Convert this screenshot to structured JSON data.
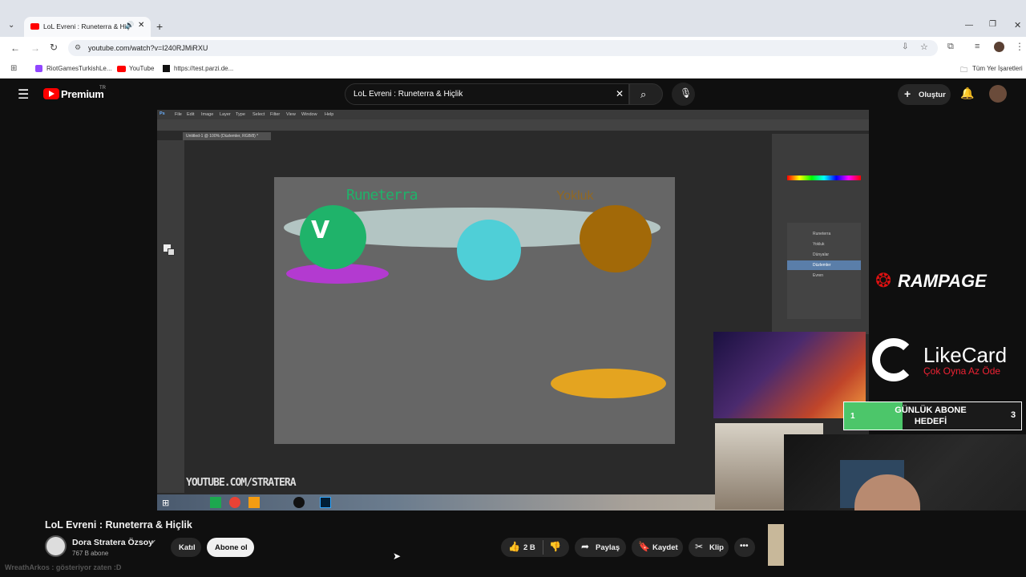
{
  "browser": {
    "tab_title": "LoL Evreni : Runeterra & Hiç",
    "url": "youtube.com/watch?v=I240RJMiRXU",
    "bookmarks": [
      "RiotGamesTurkishLe...",
      "YouTube",
      "https://test.parzi.de..."
    ],
    "bookmarks_right": "Tüm Yer İşaretleri"
  },
  "youtube": {
    "logo_text": "Premium",
    "logo_region": "TR",
    "search_query": "LoL Evreni : Runeterra & Hiçlik",
    "create_label": "Oluştur"
  },
  "video": {
    "ps_menu": [
      "Ps",
      "File",
      "Edit",
      "Image",
      "Layer",
      "Type",
      "Select",
      "Filter",
      "View",
      "Window",
      "Help"
    ],
    "doc_tab": "Untitled-1 @ 100% (Düzlemler, RGB/8) *",
    "canvas_text_runeterra": "Runeterra",
    "canvas_text_yokluk": "Yokluk",
    "layers": [
      "Runeterra",
      "Yokluk",
      "Dünyalar",
      "Düzlemler",
      "Evren"
    ],
    "watermark": "YOUTUBE.COM/STRATERA",
    "overlay_brand": "RAMPAGE",
    "likecard_name": "LikeCard",
    "likecard_slogan": "Çok Oyna  Az Öde",
    "goal_title": "GÜNLÜK ABONE HEDEFİ",
    "goal_current": "1",
    "goal_target": "3",
    "goal_progress": 0.33
  },
  "info": {
    "title": "LoL Evreni : Runeterra & Hiçlik",
    "channel": "Dora Stratera Özsoy",
    "subscribers": "767 B abone",
    "join_label": "Katıl",
    "subscribe_label": "Abone ol",
    "like_count": "2 B",
    "share_label": "Paylaş",
    "save_label": "Kaydet",
    "clip_label": "Klip",
    "chat_line": "WreathArkos : gösteriyor zaten :D"
  },
  "colors": {
    "youtube_red": "#ff0000",
    "canvas_green": "#1fb36a",
    "canvas_cyan": "#4fcfd7",
    "canvas_brown": "#a26908",
    "canvas_purple": "#b33ad0",
    "canvas_orange": "#e4a420",
    "goal_green": "#4cc66a"
  }
}
